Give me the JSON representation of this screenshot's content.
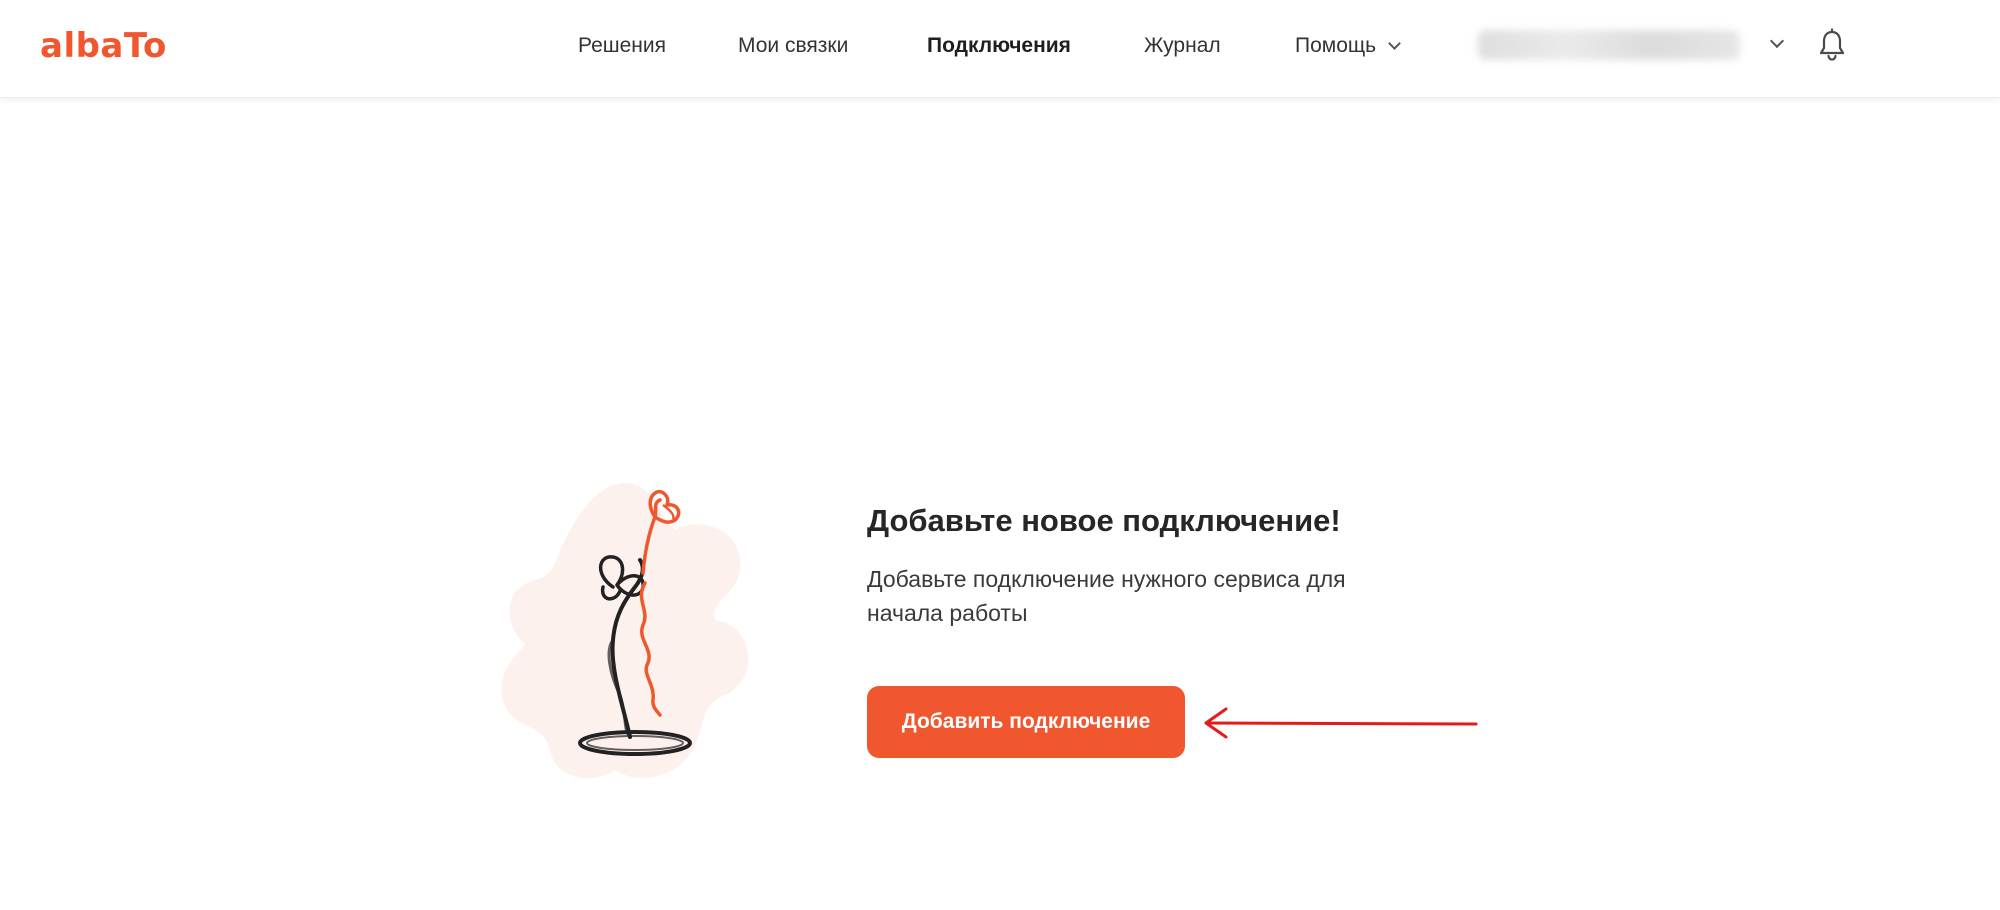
{
  "brand": {
    "logo_text": "albaTo",
    "accent_color": "#f0572e"
  },
  "nav": {
    "items": [
      {
        "label": "Решения",
        "active": false
      },
      {
        "label": "Мои связки",
        "active": false
      },
      {
        "label": "Подключения",
        "active": true
      },
      {
        "label": "Журнал",
        "active": false
      },
      {
        "label": "Помощь",
        "active": false,
        "has_dropdown": true
      }
    ]
  },
  "account": {
    "icons": [
      "chevron-down-icon",
      "bell-icon"
    ]
  },
  "empty_state": {
    "title": "Добавьте новое подключение!",
    "description": "Добавьте подключение нужного сервиса для начала работы",
    "button_label": "Добавить подключение",
    "annotation": "red-arrow-pointing-left"
  },
  "colors": {
    "button_bg": "#f0572e",
    "arrow": "#e41b1b",
    "blob": "#fdf1ed"
  }
}
